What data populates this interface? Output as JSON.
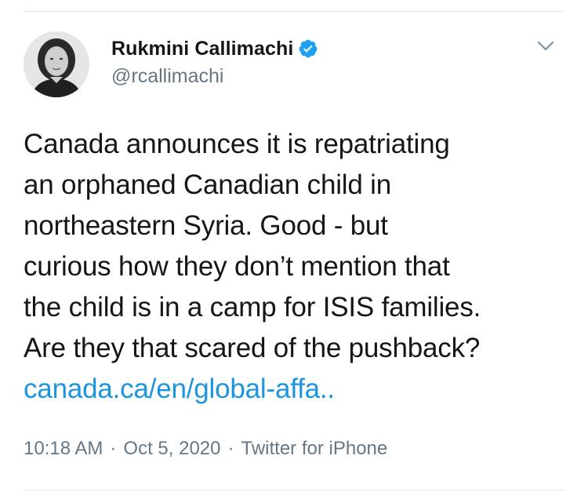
{
  "author": {
    "display_name": "Rukmini Callimachi",
    "handle": "@rcallimachi",
    "verified": true,
    "avatar_icon": "person-avatar-photo"
  },
  "tweet": {
    "lines": [
      "Canada announces it is repatriating",
      "an orphaned Canadian child in",
      "northeastern Syria. Good - but",
      "curious how they don’t mention that",
      "the child is in a camp for ISIS families.",
      "Are they that scared of the pushback?"
    ],
    "link_text": "canada.ca/en/global-affa.."
  },
  "meta": {
    "time": "10:18 AM",
    "separator": "·",
    "date": "Oct 5, 2020",
    "source": "Twitter for iPhone"
  },
  "icons": {
    "verified": "verified-badge-icon",
    "menu": "chevron-down-icon"
  },
  "colors": {
    "text": "#14171a",
    "secondary": "#657786",
    "link": "#1b95e0",
    "verified": "#1da1f2",
    "divider": "#e1e8ed"
  }
}
